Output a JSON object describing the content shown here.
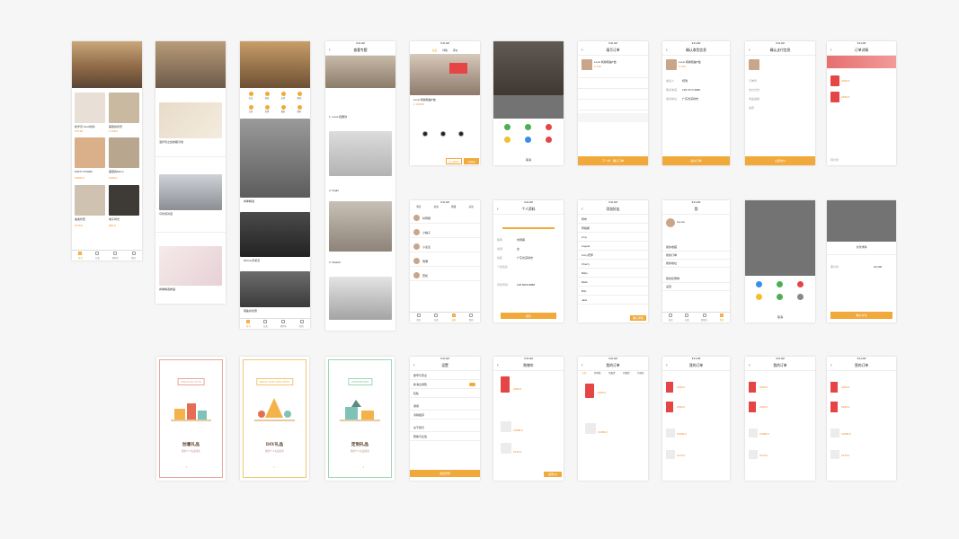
{
  "colors": {
    "accent": "#f0a93a",
    "price": "#f08a24",
    "brand_red": "#e64545"
  },
  "status": {
    "carrier": "Sketch",
    "time": "9:41 AM"
  },
  "tabs": [
    "首页",
    "分类",
    "发现",
    "购物车",
    "我的"
  ],
  "screens": {
    "s1": {
      "items": [
        {
          "title": "新岁月·Orez时尚",
          "price": "¥79.00"
        },
        {
          "title": "美丽的风景",
          "price": "¥ 108.0"
        },
        {
          "title": "SONY ST0000",
          "price": "¥1699.0"
        },
        {
          "title": "美丽的Moon",
          "price": "¥108.0"
        },
        {
          "title": "迪奥外套",
          "price": "¥179.0"
        },
        {
          "title": "电子时光",
          "price": "¥98.0"
        }
      ]
    },
    "s2": {
      "post1": "漫步风之谷的路与线",
      "post2": "与时间对话",
      "post3": "春季精选物语"
    },
    "s3": {
      "cats": [
        "礼品",
        "创意",
        "玩具",
        "家居",
        "文具",
        "美食",
        "摄影",
        "数码"
      ],
      "post1": "春季精选",
      "post2": "iPhone手机壳",
      "post3": "钥匙扣创意"
    },
    "s4": {
      "nav_title": "查看专题",
      "a1": "1. Levis 经典款",
      "a2": "2. Ktight",
      "a3": "3. Swatch"
    },
    "s5": {
      "tabs": [
        "商品",
        "详情",
        "评价"
      ],
      "title": "Levis 纯棉短袖T恤",
      "price": "¥ 149.00",
      "add": "加入购物车",
      "buy": "立即购买"
    },
    "s6": {
      "share": "分享",
      "opts": [
        "朋友圈",
        "微信好友",
        "微博",
        "QQ空间"
      ],
      "cancel": "取消"
    },
    "s7": {
      "nav_title": "填写订单",
      "title": "Levis 纯棉短袖T恤",
      "price": "¥ 149",
      "submit": "下一步：确认订单"
    },
    "s8": {
      "nav_title": "确认收货信息",
      "title": "Levis 纯棉短袖T恤",
      "price": "¥ 149",
      "fields": [
        "收货人",
        "联系电话",
        "收货地址"
      ],
      "values": [
        "柯瑞",
        "138 7274 9080",
        "广东省深圳市"
      ],
      "submit": "提交订单"
    },
    "s9": {
      "nav_title": "确认支付信息",
      "fields": [
        "订单号",
        "支付方式",
        "商品金额",
        "运费"
      ],
      "submit": "立即支付"
    },
    "s10": {
      "nav_title": "订单详情",
      "total": "¥296.0",
      "total2": "¥396.0",
      "status": "待付款"
    },
    "s11": {
      "tabs": [
        "消息",
        "好友",
        "群组",
        "关注"
      ],
      "names": [
        "刘玥楠",
        "小柚子",
        "小麦麦",
        "瑞珊",
        "雷凯"
      ]
    },
    "s12": {
      "nav_title": "个人资料",
      "fields": [
        "昵称",
        "性别",
        "地区",
        "个性签名",
        "手机号码"
      ],
      "values": [
        "刘玥楠",
        "女",
        "广东省深圳市",
        "",
        "138 6666 8888"
      ],
      "save": "保存"
    },
    "s13": {
      "nav_title": "添加好友",
      "names": [
        "阿布",
        "阿格斯",
        "Amy",
        "Angela",
        "Anny老师",
        "Cherry",
        "Baby",
        "Bella",
        "Bob",
        "Jack"
      ],
      "confirm": "确认添加"
    },
    "s14": {
      "nav_title": "我",
      "user": "Lemon",
      "menu": [
        "我的收藏",
        "我的订单",
        "我的地址",
        "我的优惠券",
        "设置"
      ]
    },
    "s16": {
      "nav_title": "订单详情",
      "pay_title": "付款详情",
      "confirm": "确认付款",
      "pay_label": "需付款",
      "amount": "¥2,000"
    },
    "s17": {
      "en": "CREATIVE GIFTS",
      "title": "创意礼品",
      "sub": "我的个人礼品专家"
    },
    "s18": {
      "en": "MAKE YOUR OWN GIFTS",
      "title": "DIY礼品",
      "sub": "我的个人礼品专家"
    },
    "s19": {
      "en": "CUSTOM GIFT",
      "title": "定制礼品",
      "sub": "我的个人礼品专家"
    },
    "s20": {
      "nav_title": "设置",
      "items": [
        "账号与安全",
        "新消息通知",
        "隐私",
        "通用",
        "清除缓存",
        "关于我们",
        "帮助与反馈"
      ],
      "logout": "退出登录"
    },
    "s21": {
      "nav_title": "购物车",
      "prices": [
        "¥396.0",
        "¥1089.0",
        "¥279.0"
      ],
      "checkout": "结算(3)"
    },
    "s22": {
      "nav_title": "我的订单",
      "tabs": [
        "全部",
        "待付款",
        "待发货",
        "待收货",
        "待评价"
      ],
      "prices": [
        "¥396.0",
        "¥1089.0"
      ]
    },
    "s23": {
      "nav_title": "我的订单",
      "prices": [
        "¥296.0",
        "¥396.0",
        "¥1089.0",
        "¥279.0"
      ]
    },
    "s24": {
      "nav_title": "我的订单",
      "prices": [
        "¥296.0",
        "¥396.0",
        "¥1089.0",
        "¥279.0"
      ]
    },
    "s25": {
      "nav_title": "我的订单",
      "prices": [
        "¥296.0",
        "¥396.0",
        "¥1089.0",
        "¥279.0"
      ]
    }
  }
}
